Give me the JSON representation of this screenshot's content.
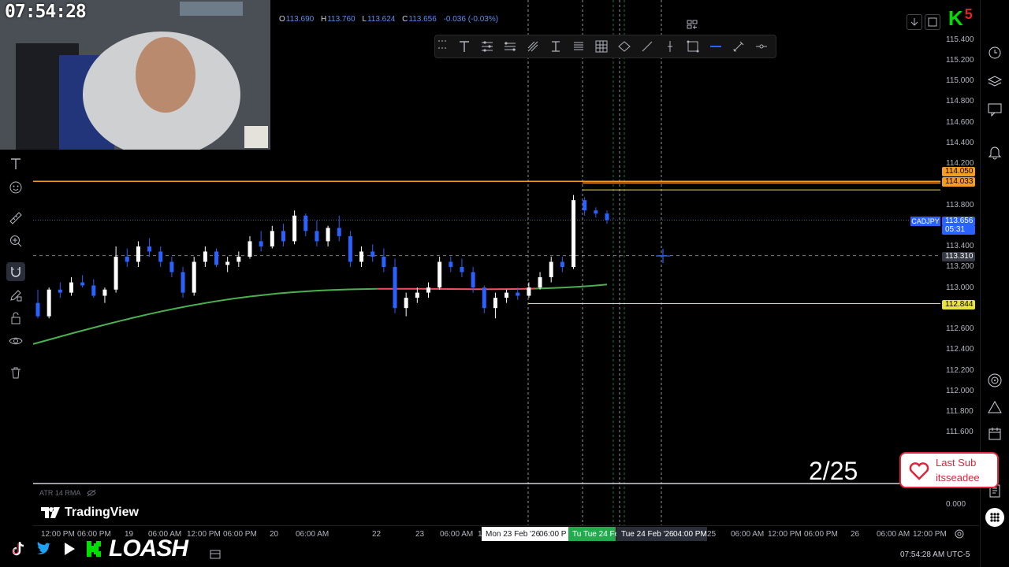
{
  "overlay": {
    "clock": "07:54:28",
    "date_badge": "2/25",
    "last_sub_title": "Last Sub",
    "last_sub_name": "itsseadee",
    "brand_name": "LOASH",
    "brand_k": "K",
    "brand_badge": "5"
  },
  "ohlc": {
    "open_label": "O",
    "open": "113.690",
    "high_label": "H",
    "high": "113.760",
    "low_label": "L",
    "low": "113.624",
    "close_label": "C",
    "close": "113.656",
    "change": "-0.036 (-0.03%)"
  },
  "drawing_toolbar": {
    "tools": [
      "text-icon",
      "multi-line-icon",
      "bars-pattern-icon",
      "path-icon",
      "text-cursor-icon",
      "list-lines-icon",
      "grid-icon",
      "diamond-icon",
      "trendline-icon",
      "vertical-line-icon",
      "rectangle-icon",
      "horizontal-line-icon",
      "brush-icon",
      "horizontal-ray-icon"
    ]
  },
  "left_toolbar": {
    "tools": [
      "text-icon",
      "emoji-icon",
      "ruler-icon",
      "zoom-in-icon",
      "magnet-icon",
      "pencil-lock-icon",
      "lock-icon",
      "eye-icon",
      "trash-icon"
    ]
  },
  "right_sidebar": {
    "tools": [
      "alarm-clock-icon",
      "layers-icon",
      "chat-icon",
      "bell-icon",
      "target-icon",
      "triangle-icon",
      "calendar-icon",
      "notebook-icon",
      "grid-dots-icon"
    ]
  },
  "price_axis": {
    "ticks": [
      "115.400",
      "115.200",
      "115.000",
      "114.800",
      "114.600",
      "114.400",
      "114.200",
      "113.800",
      "113.600",
      "113.400",
      "113.200",
      "113.000",
      "112.800",
      "112.600",
      "112.400",
      "112.200",
      "112.000",
      "111.800",
      "111.600",
      "0.000"
    ],
    "labels": {
      "orange_top": "114.050",
      "orange_level": "114.033",
      "symbol": "CADJPY",
      "last_price": "113.656",
      "countdown": "05:31",
      "crosshair": "113.310",
      "yellow_level": "112.844"
    },
    "colors": {
      "orange": "#f59d22",
      "yellow": "#e8e23a",
      "blue": "#2962ff",
      "crosshair": "#363a45"
    }
  },
  "time_axis": {
    "ticks": [
      "12:00 PM",
      "06:00 PM",
      "19",
      "06:00 AM",
      "12:00 PM",
      "06:00 PM",
      "20",
      "06:00 AM",
      "22",
      "23",
      "06:00 AM",
      "1",
      "25",
      "06:00 AM",
      "12:00 PM",
      "06:00 PM",
      "26",
      "06:00 AM",
      "12:00 PM"
    ],
    "highlights": [
      "Mon 23 Feb '26",
      "06:00 P",
      "Tu",
      "Tue 24 Fe",
      "Tue 24 Feb '26",
      "04:00 PM"
    ],
    "footer_time": "07:54:28 AM UTC-5"
  },
  "indicator": {
    "name": "ATR 14 RMA"
  },
  "branding": {
    "tradingview": "TradingView"
  },
  "chart_data": {
    "type": "candlestick",
    "symbol": "CADJPY",
    "candles_ohlc": [
      [
        112.85,
        112.98,
        112.7,
        112.72
      ],
      [
        112.72,
        113.0,
        112.7,
        112.98
      ],
      [
        112.98,
        113.05,
        112.9,
        112.95
      ],
      [
        112.95,
        113.1,
        112.92,
        113.05
      ],
      [
        113.05,
        113.12,
        113.0,
        113.02
      ],
      [
        113.02,
        113.08,
        112.9,
        112.92
      ],
      [
        112.92,
        113.0,
        112.85,
        112.98
      ],
      [
        112.98,
        113.4,
        112.95,
        113.3
      ],
      [
        113.3,
        113.38,
        113.2,
        113.25
      ],
      [
        113.25,
        113.45,
        113.2,
        113.4
      ],
      [
        113.4,
        113.48,
        113.3,
        113.35
      ],
      [
        113.35,
        113.4,
        113.2,
        113.25
      ],
      [
        113.25,
        113.3,
        113.1,
        113.15
      ],
      [
        113.15,
        113.2,
        112.9,
        112.95
      ],
      [
        112.95,
        113.3,
        112.92,
        113.25
      ],
      [
        113.25,
        113.4,
        113.2,
        113.35
      ],
      [
        113.35,
        113.38,
        113.2,
        113.22
      ],
      [
        113.22,
        113.3,
        113.15,
        113.25
      ],
      [
        113.25,
        113.35,
        113.2,
        113.3
      ],
      [
        113.3,
        113.5,
        113.28,
        113.45
      ],
      [
        113.45,
        113.55,
        113.35,
        113.4
      ],
      [
        113.4,
        113.6,
        113.38,
        113.55
      ],
      [
        113.55,
        113.62,
        113.4,
        113.45
      ],
      [
        113.45,
        113.75,
        113.42,
        113.7
      ],
      [
        113.7,
        113.72,
        113.5,
        113.55
      ],
      [
        113.55,
        113.65,
        113.4,
        113.45
      ],
      [
        113.45,
        113.6,
        113.4,
        113.58
      ],
      [
        113.58,
        113.7,
        113.45,
        113.5
      ],
      [
        113.5,
        113.55,
        113.2,
        113.25
      ],
      [
        113.25,
        113.4,
        113.2,
        113.35
      ],
      [
        113.35,
        113.42,
        113.25,
        113.3
      ],
      [
        113.3,
        113.38,
        113.15,
        113.2
      ],
      [
        113.2,
        113.28,
        112.75,
        112.8
      ],
      [
        112.8,
        112.95,
        112.72,
        112.9
      ],
      [
        112.9,
        113.0,
        112.85,
        112.95
      ],
      [
        112.95,
        113.05,
        112.9,
        113.0
      ],
      [
        113.0,
        113.3,
        112.98,
        113.25
      ],
      [
        113.25,
        113.3,
        113.15,
        113.2
      ],
      [
        113.2,
        113.28,
        113.1,
        113.15
      ],
      [
        113.15,
        113.2,
        112.95,
        113.0
      ],
      [
        113.0,
        113.02,
        112.75,
        112.8
      ],
      [
        112.8,
        112.95,
        112.7,
        112.9
      ],
      [
        112.9,
        112.98,
        112.85,
        112.95
      ],
      [
        112.95,
        113.0,
        112.88,
        112.92
      ],
      [
        112.92,
        113.05,
        112.9,
        113.0
      ],
      [
        113.0,
        113.15,
        112.98,
        113.1
      ],
      [
        113.1,
        113.3,
        113.05,
        113.25
      ],
      [
        113.25,
        113.3,
        113.15,
        113.2
      ],
      [
        113.2,
        113.9,
        113.18,
        113.85
      ],
      [
        113.85,
        113.88,
        113.7,
        113.75
      ],
      [
        113.75,
        113.78,
        113.68,
        113.72
      ],
      [
        113.72,
        113.75,
        113.62,
        113.656
      ]
    ],
    "ma_start": 112.45,
    "ma_end": 113.2,
    "levels": {
      "orange": 114.033,
      "yellow_top": 113.95,
      "yellow_low": 112.844,
      "crosshair": 113.31,
      "last": 113.656
    }
  }
}
